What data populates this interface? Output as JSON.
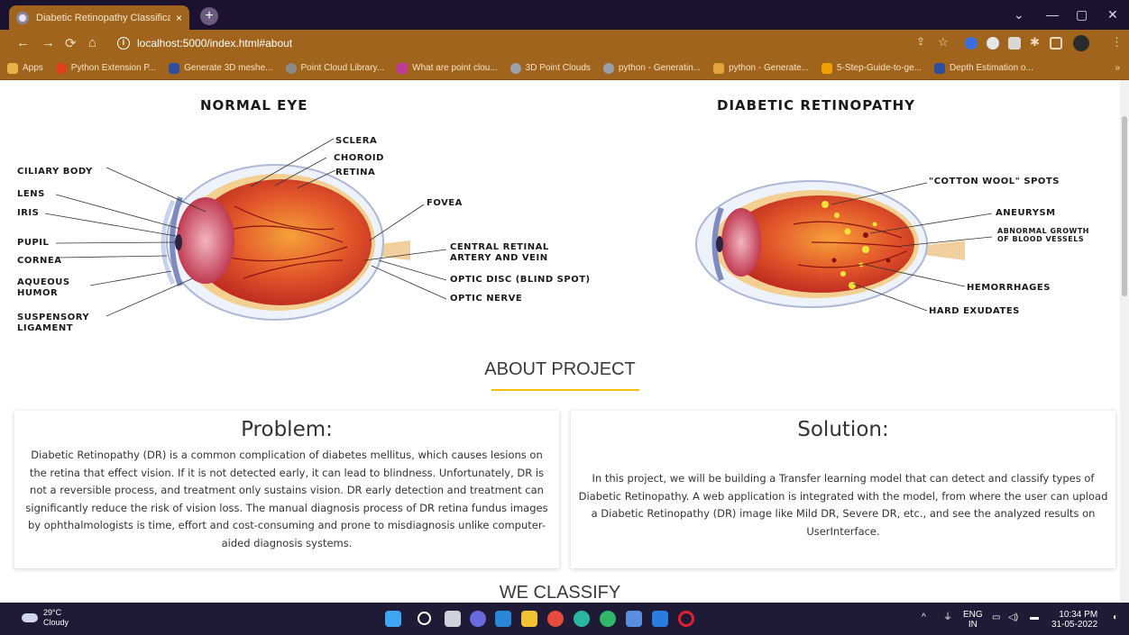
{
  "browser": {
    "tab_title": "Diabetic Retinopathy Classificati",
    "tab_close": "×",
    "new_tab": "+",
    "url": "localhost:5000/index.html#about",
    "window_controls": [
      "⌄",
      "—",
      "▢",
      "✕"
    ],
    "bookmarks": [
      {
        "label": "Apps",
        "color": "#e8b04a"
      },
      {
        "label": "Python Extension P...",
        "color": "#e0401c"
      },
      {
        "label": "Generate 3D meshe...",
        "color": "#2c4fa0"
      },
      {
        "label": "Point Cloud Library...",
        "color": "#8a8a8a"
      },
      {
        "label": "What are point clou...",
        "color": "#c03a9a"
      },
      {
        "label": "3D Point Clouds",
        "color": "#9aa0aa"
      },
      {
        "label": "python - Generatin...",
        "color": "#9aa0aa"
      },
      {
        "label": "python - Generate...",
        "color": "#e6a23c"
      },
      {
        "label": "5-Step-Guide-to-ge...",
        "color": "#f0a000"
      },
      {
        "label": "Depth Estimation o...",
        "color": "#2c4fa0"
      }
    ],
    "bookmarks_more": "»"
  },
  "diagrams": {
    "normal": {
      "title": "NORMAL EYE",
      "labels": {
        "sclera": "SCLERA",
        "choroid": "CHOROID",
        "retina": "RETINA",
        "ciliary": "CILIARY BODY",
        "lens": "LENS",
        "iris": "IRIS",
        "fovea": "FOVEA",
        "pupil": "PUPIL",
        "cornea": "CORNEA",
        "central": "CENTRAL RETINAL\nARTERY AND VEIN",
        "aqueous": "AQUEOUS\nHUMOR",
        "optic_disc": "OPTIC DISC (BLIND SPOT)",
        "optic_nerve": "OPTIC NERVE",
        "suspensory": "SUSPENSORY\nLIGAMENT"
      }
    },
    "dr": {
      "title": "DIABETIC RETINOPATHY",
      "labels": {
        "cotton": "\"COTTON WOOL\" SPOTS",
        "aneurysm": "ANEURYSM",
        "abnormal": "ABNORMAL GROWTH\nOF BLOOD VESSELS",
        "hemorrhages": "HEMORRHAGES",
        "hard": "HARD EXUDATES"
      }
    }
  },
  "about": {
    "title": "ABOUT PROJECT",
    "problem": {
      "heading": "Problem:",
      "text": "Diabetic Retinopathy (DR) is a common complication of diabetes mellitus, which causes lesions on the retina that effect vision. If it is not detected early, it can lead to blindness. Unfortunately, DR is not a reversible process, and treatment only sustains vision. DR early detection and treatment can significantly reduce the risk of vision loss. The manual diagnosis process of DR retina fundus images by ophthalmologists is time, effort and cost-consuming and prone to misdiagnosis unlike computer-aided diagnosis systems."
    },
    "solution": {
      "heading": "Solution:",
      "text": "In this project, we will be building a Transfer learning model that can detect and classify types of Diabetic Retinopathy. A web application is integrated with the model, from where the user can upload a Diabetic Retinopathy (DR) image like Mild DR, Severe DR, etc., and see the analyzed results on UserInterface."
    }
  },
  "classify": {
    "title": "WE CLASSIFY"
  },
  "taskbar": {
    "temperature": "29°C",
    "weather": "Cloudy",
    "lang_top": "ENG",
    "lang_bottom": "IN",
    "time": "10:34 PM",
    "date": "31-05-2022"
  },
  "colors": {
    "accent": "#f3c000",
    "chrome": "#a0641c",
    "taskbar": "#1f1a36"
  }
}
